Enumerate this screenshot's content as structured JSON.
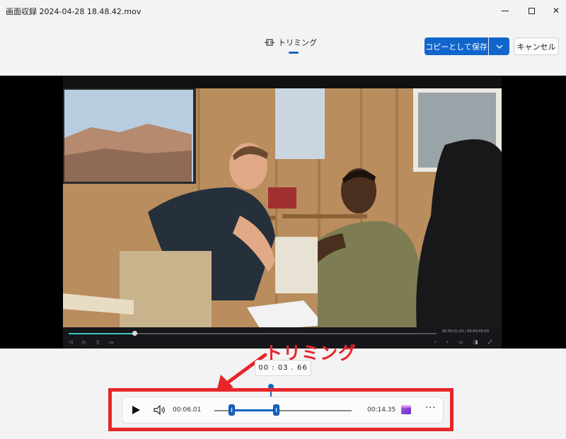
{
  "window": {
    "title": "画面収録 2024-04-28 18.48.42.mov"
  },
  "toolbar": {
    "tab_label": "トリミング",
    "save_label": "コピーとして保存",
    "cancel_label": "キャンセル"
  },
  "embedded_player": {
    "time_readout": "00:00:01:03 / 00:00:09:03",
    "progress_fraction": 0.18
  },
  "annotation": {
    "label": "トリミング",
    "color": "#e8252a"
  },
  "tooltip": {
    "time": "00 : 03 . 66"
  },
  "controls": {
    "start_time": "00:06.01",
    "end_time": "00:14.35",
    "more_label": "···"
  },
  "colors": {
    "accent": "#1166cc",
    "highlight": "#e8252a"
  }
}
